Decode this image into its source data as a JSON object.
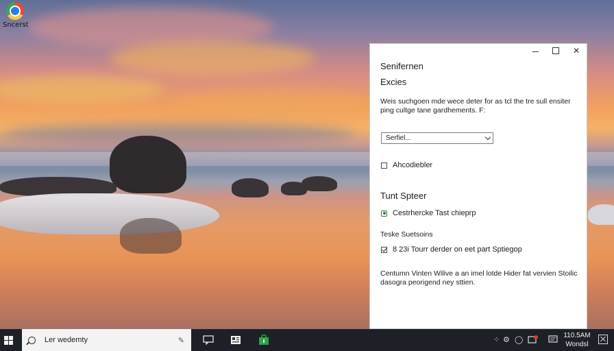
{
  "desktop": {
    "icons": [
      {
        "label": "Sncerst",
        "icon": "browser-app-icon"
      }
    ]
  },
  "dialog": {
    "title": "Senifernen",
    "subtitle": "Excies",
    "description": "Weis suchgoen mde wece deter for as tcl the tre sull ensiter ping cultge tane gardhements. F:",
    "dropdown": {
      "value": "Serfiel..."
    },
    "checkbox1": {
      "label": "Ahcodiebler",
      "checked": false
    },
    "section_title": "Tunt Spteer",
    "option1": {
      "label": "Cestrhercke Tast chieprp",
      "selected": true
    },
    "section_sub": "Teske Suetsoins",
    "checkbox2": {
      "label": "8 23i Tourr derder on eet part Sptiegop",
      "checked": true
    },
    "footer": "Centumn Vinten Wilive a an imel lotde Hider fat vervien Stoilic dasogra peorigend ney sttien."
  },
  "taskbar": {
    "search_text": "Ler wedemty",
    "clock": {
      "time": "110.5AM",
      "label": "Wondsl"
    },
    "pinned": [
      "chat-icon",
      "news-icon",
      "store-bag-icon"
    ],
    "tray": [
      "network-icon",
      "settings-icon",
      "circle-icon",
      "notification-badge-icon",
      "screen-icon"
    ]
  },
  "colors": {
    "accent_green": "#2f7a3a",
    "taskbar": "#1d2127",
    "badge_red": "#e0392b"
  }
}
